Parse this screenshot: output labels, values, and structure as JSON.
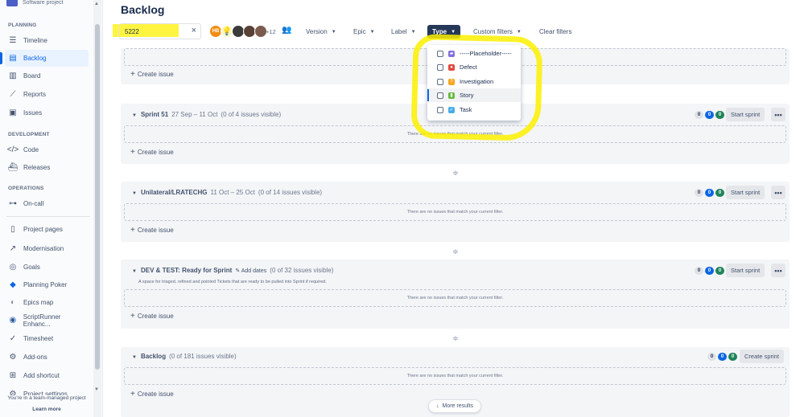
{
  "sidebar": {
    "project_subtitle": "Software project",
    "sections": {
      "planning": "PLANNING",
      "development": "DEVELOPMENT",
      "operations": "OPERATIONS"
    },
    "items": [
      {
        "label": "Timeline",
        "icon": "timeline-icon"
      },
      {
        "label": "Backlog",
        "icon": "backlog-icon",
        "active": true
      },
      {
        "label": "Board",
        "icon": "board-icon"
      },
      {
        "label": "Reports",
        "icon": "reports-icon"
      },
      {
        "label": "Issues",
        "icon": "issues-icon"
      },
      {
        "label": "Code",
        "icon": "code-icon"
      },
      {
        "label": "Releases",
        "icon": "releases-icon"
      },
      {
        "label": "On-call",
        "icon": "on-call-icon"
      },
      {
        "label": "Project pages",
        "icon": "page-icon"
      },
      {
        "label": "Modernisation",
        "icon": "external-link-icon"
      },
      {
        "label": "Goals",
        "icon": "goals-icon"
      },
      {
        "label": "Planning Poker",
        "icon": "planning-poker-icon"
      },
      {
        "label": "Epics map",
        "icon": "epics-map-icon"
      },
      {
        "label": "ScriptRunner Enhanc...",
        "icon": "scriptrunner-icon"
      },
      {
        "label": "Timesheet",
        "icon": "timesheet-icon"
      },
      {
        "label": "Add-ons",
        "icon": "add-ons-icon"
      },
      {
        "label": "Add shortcut",
        "icon": "add-shortcut-icon"
      },
      {
        "label": "Project settings",
        "icon": "settings-icon"
      }
    ],
    "footer": {
      "text": "You're in a team-managed project",
      "link": "Learn more"
    }
  },
  "header": {
    "title": "Backlog"
  },
  "filters": {
    "search_value": "5222",
    "avatar_initials": "HB",
    "avatars_more": "+12",
    "version": "Version",
    "epic": "Epic",
    "label": "Label",
    "type": "Type",
    "custom": "Custom filters",
    "clear": "Clear filters"
  },
  "type_dropdown": {
    "options": [
      {
        "label": "-----Placeholder-----",
        "color": "#8270db",
        "glyph": "▰"
      },
      {
        "label": "Defect",
        "color": "#e2483d",
        "glyph": "●"
      },
      {
        "label": "Investigation",
        "color": "#f5a623",
        "glyph": "?"
      },
      {
        "label": "Story",
        "color": "#63ba3c",
        "glyph": "▮"
      },
      {
        "label": "Task",
        "color": "#4bade8",
        "glyph": "✓"
      }
    ]
  },
  "empty_text": "There are no issues that match your current filter.",
  "create_issue": "Create issue",
  "top_panel": {
    "empty_text_partial": "There are no"
  },
  "sprints": [
    {
      "name": "Sprint 51",
      "dates": "27 Sep – 11 Oct",
      "visible": "(0 of 4 issues visible)",
      "counts": [
        "0",
        "0",
        "0"
      ],
      "action": "Start sprint"
    },
    {
      "name": "Unilateral/LRATECHG",
      "dates": "11 Oct – 25 Oct",
      "visible": "(0 of 14 issues visible)",
      "counts": [
        "0",
        "0",
        "0"
      ],
      "action": "Start sprint"
    },
    {
      "name": "DEV & TEST: Ready for Sprint",
      "add_dates": "Add dates",
      "visible": "(0 of 32 issues visible)",
      "description": "A space for triaged, refined and pointed Tickets that are ready to be pulled into Sprint if required.",
      "counts": [
        "0",
        "0",
        "0"
      ],
      "action": "Start sprint"
    }
  ],
  "backlog": {
    "name": "Backlog",
    "visible": "(0 of 181 issues visible)",
    "counts": [
      "0",
      "0",
      "0"
    ],
    "action": "Create sprint"
  },
  "more_results": "More results",
  "colors": {
    "accent": "#0c66e4",
    "highlight": "#fcf000",
    "active_filter": "#253858"
  }
}
